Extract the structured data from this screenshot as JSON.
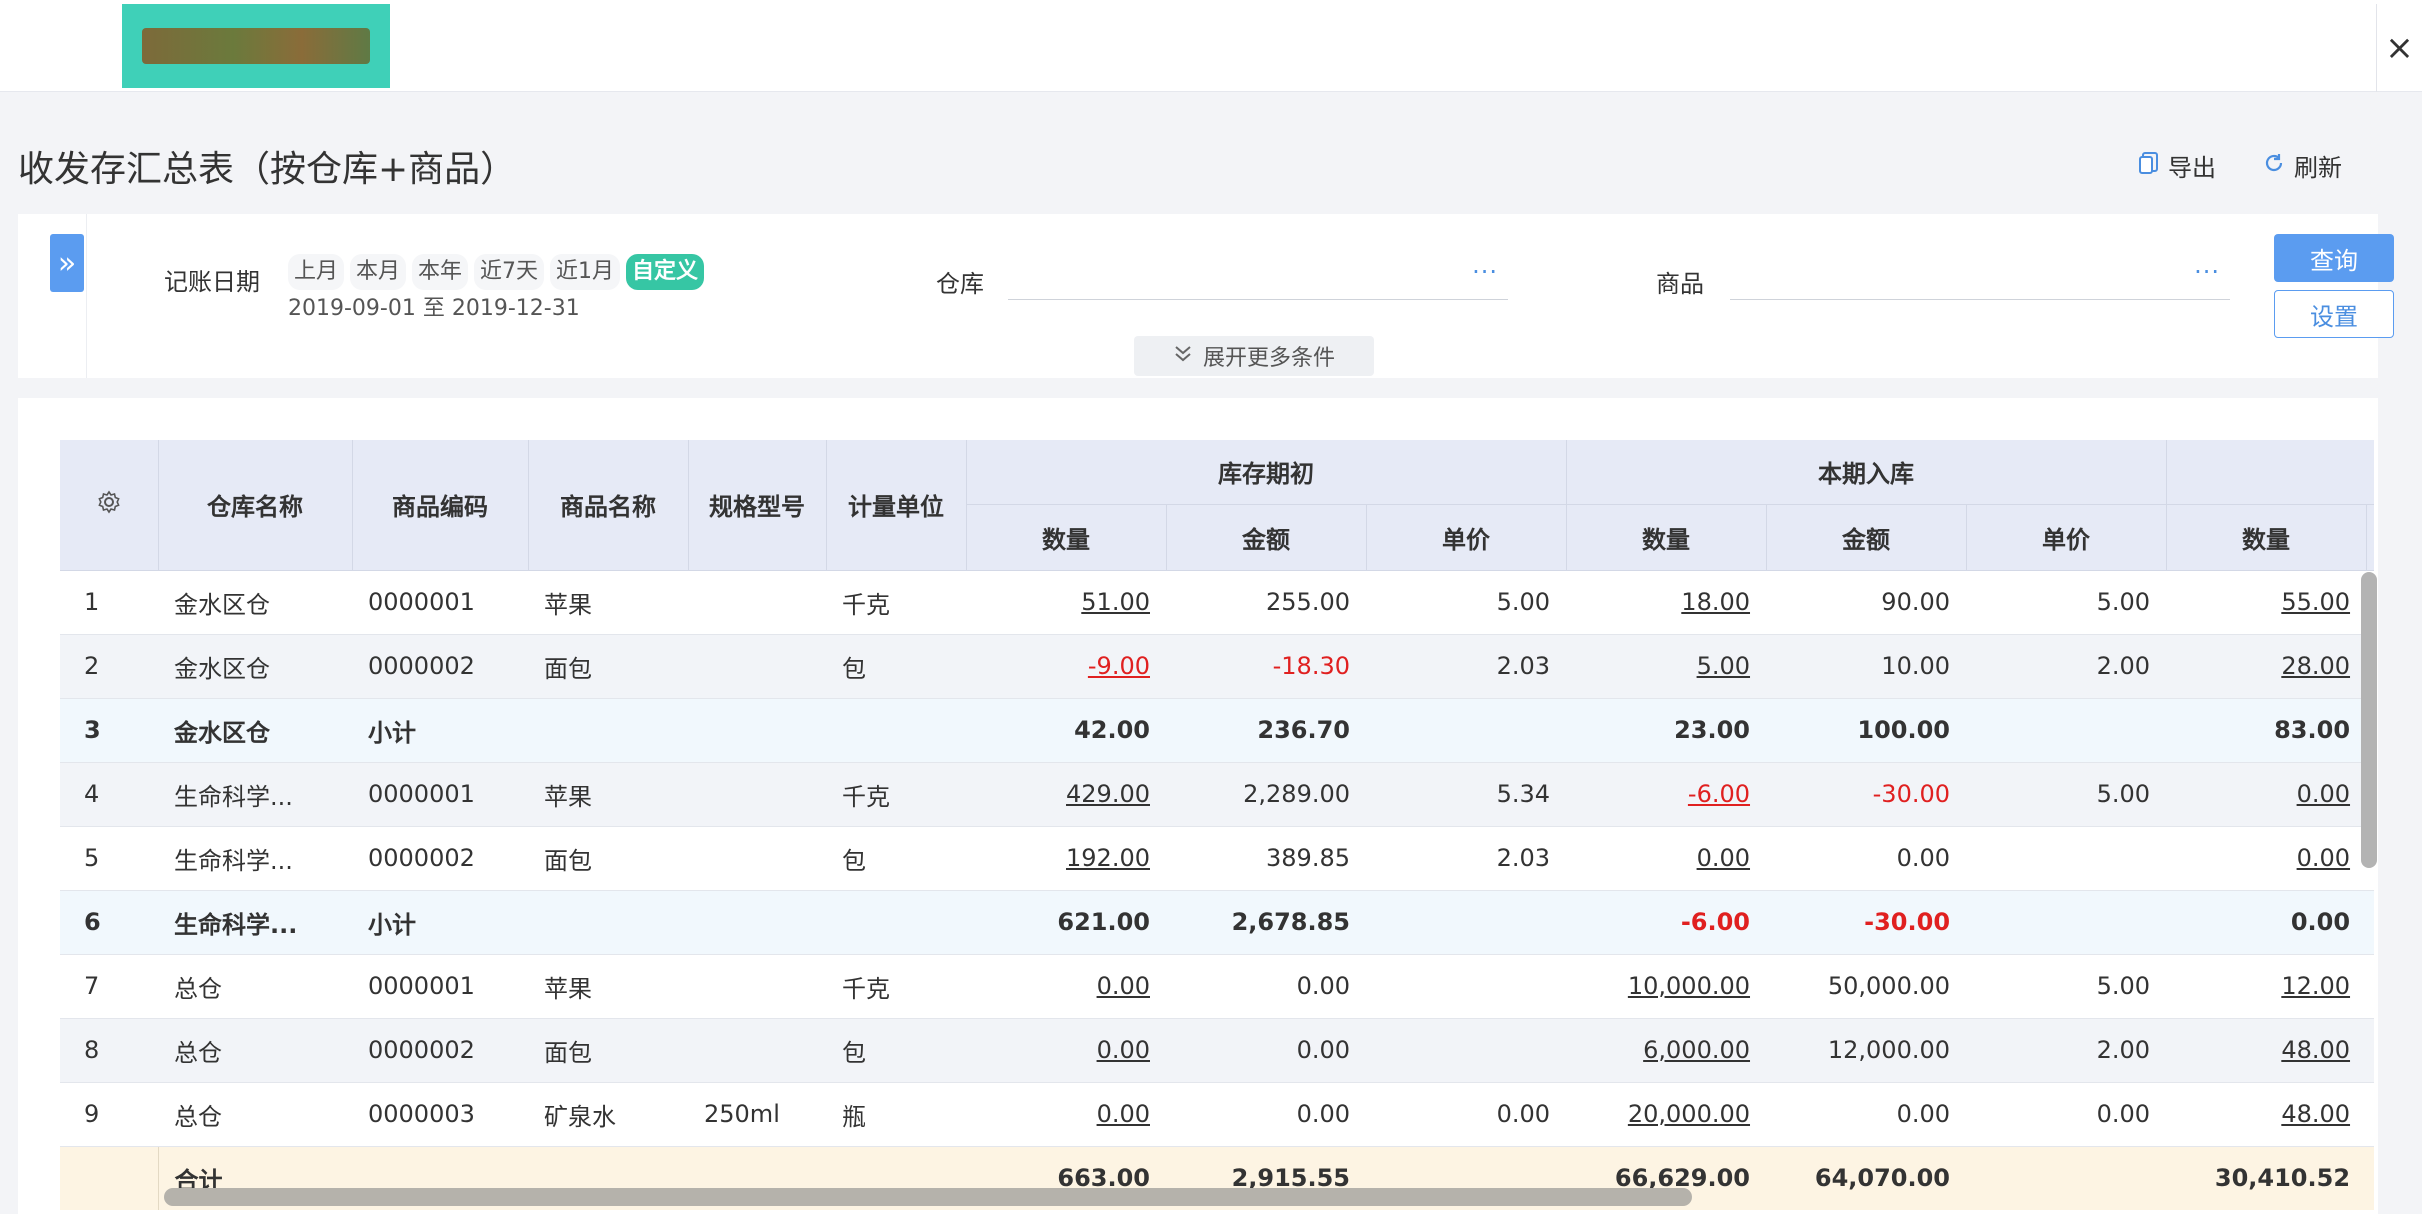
{
  "app": {
    "close_symbol": "×"
  },
  "page": {
    "title": "收发存汇总表（按仓库+商品）"
  },
  "actions": {
    "export_label": "导出",
    "refresh_label": "刷新"
  },
  "filters": {
    "date_label": "记账日期",
    "date_chips": [
      "上月",
      "本月",
      "本年",
      "近7天",
      "近1月",
      "自定义"
    ],
    "active_chip": "自定义",
    "date_range": "2019-09-01 至 2019-12-31",
    "warehouse_label": "仓库",
    "warehouse_value": "",
    "goods_label": "商品",
    "goods_value": "",
    "dots": "···",
    "expand_label": "展开更多条件",
    "query_label": "查询",
    "settings_label": "设置"
  },
  "table": {
    "headers": [
      "仓库名称",
      "商品编码",
      "商品名称",
      "规格型号",
      "计量单位"
    ],
    "groups": [
      "库存期初",
      "本期入库"
    ],
    "sub_headers": [
      "数量",
      "金额",
      "单价",
      "数量",
      "金额",
      "单价",
      "数量"
    ],
    "rows": [
      {
        "kind": "odd",
        "cells": [
          "1",
          "金水区仓",
          "0000001",
          "苹果",
          "",
          "千克",
          "51.00",
          "255.00",
          "5.00",
          "18.00",
          "90.00",
          "5.00",
          "55.00"
        ]
      },
      {
        "kind": "even",
        "cells": [
          "2",
          "金水区仓",
          "0000002",
          "面包",
          "",
          "包",
          "-9.00",
          "-18.30",
          "2.03",
          "5.00",
          "10.00",
          "2.00",
          "28.00"
        ]
      },
      {
        "kind": "sub",
        "cells": [
          "3",
          "金水区仓",
          "小计",
          "",
          "",
          "",
          "42.00",
          "236.70",
          "",
          "23.00",
          "100.00",
          "",
          "83.00"
        ]
      },
      {
        "kind": "even",
        "cells": [
          "4",
          "生命科学...",
          "0000001",
          "苹果",
          "",
          "千克",
          "429.00",
          "2,289.00",
          "5.34",
          "-6.00",
          "-30.00",
          "5.00",
          "0.00"
        ]
      },
      {
        "kind": "odd",
        "cells": [
          "5",
          "生命科学...",
          "0000002",
          "面包",
          "",
          "包",
          "192.00",
          "389.85",
          "2.03",
          "0.00",
          "0.00",
          "",
          "0.00"
        ]
      },
      {
        "kind": "sub",
        "cells": [
          "6",
          "生命科学...",
          "小计",
          "",
          "",
          "",
          "621.00",
          "2,678.85",
          "",
          "-6.00",
          "-30.00",
          "",
          "0.00"
        ]
      },
      {
        "kind": "odd",
        "cells": [
          "7",
          "总仓",
          "0000001",
          "苹果",
          "",
          "千克",
          "0.00",
          "0.00",
          "",
          "10,000.00",
          "50,000.00",
          "5.00",
          "12.00"
        ]
      },
      {
        "kind": "even",
        "cells": [
          "8",
          "总仓",
          "0000002",
          "面包",
          "",
          "包",
          "0.00",
          "0.00",
          "",
          "6,000.00",
          "12,000.00",
          "2.00",
          "48.00"
        ]
      },
      {
        "kind": "odd",
        "cells": [
          "9",
          "总仓",
          "0000003",
          "矿泉水",
          "250ml",
          "瓶",
          "0.00",
          "0.00",
          "0.00",
          "20,000.00",
          "0.00",
          "0.00",
          "48.00"
        ]
      }
    ],
    "total": {
      "label": "合计",
      "cells": [
        "663.00",
        "2,915.55",
        "",
        "66,629.00",
        "64,070.00",
        "",
        "30,410.52"
      ]
    }
  }
}
